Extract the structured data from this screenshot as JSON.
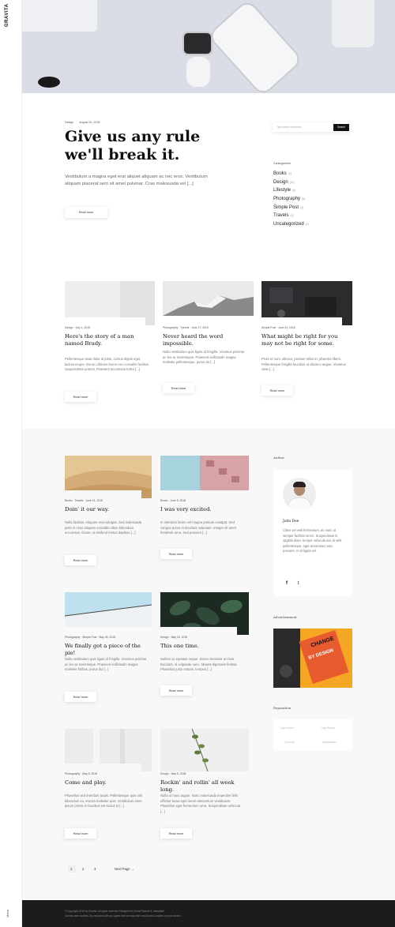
{
  "site": {
    "logo": "GRAVITA",
    "menu_label": "Menu"
  },
  "featured": {
    "category": "Design",
    "date": "August 20, 2018",
    "title": "Give us any rule we'll break it.",
    "excerpt": "Vestibulum a magna eget erat aliquet aliquam ac nec eros. Vestibulum aliquam placerat sem sit amet pulvinar. Cras malesuada vel [...]",
    "read_more": "Read more"
  },
  "search": {
    "placeholder": "Type search keywords",
    "button": "Search"
  },
  "categories": {
    "heading": "Categories",
    "items": [
      {
        "label": "Books",
        "count": "(3)"
      },
      {
        "label": "Design",
        "count": "(11)"
      },
      {
        "label": "Lifestyle",
        "count": "(4)"
      },
      {
        "label": "Photography",
        "count": "(6)"
      },
      {
        "label": "Simple Post",
        "count": "(4)"
      },
      {
        "label": "Travels",
        "count": "(4)"
      },
      {
        "label": "Uncategorized",
        "count": "(2)"
      }
    ]
  },
  "row_posts": [
    {
      "meta": "Design  ·  July 1, 2018",
      "title": "Here's the story of a man named Brady.",
      "excerpt": "Pellentesque vitae dolor id justo, cursus dignis eget, lacinia neque. Donec ultricies lorem nec convallis facilisis. Suspendisse potenti. Praesent accumsan tortor [...]",
      "read_more": "Read more"
    },
    {
      "meta": "Photography · Travels  ·  June 27, 2018",
      "title": "Never heard the word impossible.",
      "excerpt": "Nulla vestibulum quis ligula id fringilla. Vivamus pulvinar ac leo ac scelerisque. Praesent sollicitudin magna molestie pellentesque, purus du [...]",
      "read_more": "Read more"
    },
    {
      "meta": "Simple Post  ·  June 23, 2018",
      "title": "What might be right for you may not be right for some.",
      "excerpt": "Proin et nunc ultrices, pretium tellus in, pharetra libero. Pellentesque fringilla faucibus ut ullamco augue. Vivamus vitae [...]",
      "read_more": "Read more"
    }
  ],
  "grid_posts": [
    {
      "meta": "Books · Travels  ·  June 14, 2018",
      "title": "Doin' it our way.",
      "excerpt": "Nulla facilisis. Aliquam erat volutpat. Sed malesuada justo in risus aliquam convallis ullam bibendum accumsan. Donec ut eleifend metus dapibus [...]",
      "read_more": "Read more"
    },
    {
      "meta": "Books  ·  June 5, 2018",
      "title": "I was very excited.",
      "excerpt": "In interdum lorem vel magna pretium volutpat. Sed congue purus in tincidunt vulputate. Integer sit amet hendrerit urna. Sed posuere [...]",
      "read_more": "Read more"
    },
    {
      "meta": "Photography · Simple Post  ·  May 28, 2018",
      "title": "We finally got a piece of the pie!",
      "excerpt": "Nulla vestibulum quis ligula id fringilla. Vivamus pulvinar ac leo ac scelerisque. Praesent sollicitudin magna molestie finibus, purus dui [...]",
      "read_more": "Read more"
    },
    {
      "meta": "Design  ·  May 16, 2018",
      "title": "This one time.",
      "excerpt": "Nullam ac egestas neque. Donec tincidunt at risus tincidunt, id vulputate nunc. Mauris dignissim finibus. Phasellus justo mauris, tempus [...]",
      "read_more": "Read more"
    },
    {
      "meta": "Photography  ·  May 8, 2018",
      "title": "Come and play.",
      "excerpt": "Phasellus sed interdum turpis. Pellentesque quis nisl bibendum ex, viverra molestie quis. Vestibulum enim ipsum primis in faucibus est luctus et [...]",
      "read_more": "Read more"
    },
    {
      "meta": "Design  ·  May 8, 2018",
      "title": "Rockin' and rollin' all week long.",
      "excerpt": "Nulla ut nunc augue. Nunc malesuada imperdiet felis efficitur lacus eget lorem elementum vestibulum. Phasellus eget fermentum urna. Suspendisse vehicula [...]",
      "read_more": "Read more"
    }
  ],
  "sidebar": {
    "author_heading": "Author",
    "author_name": "John Doe",
    "author_bio": "Class vel velit fermentum, ac nunc at semper facilisis lorem. Suspendisse in sagittis diam, tempor vehicula nisi at velit pellentesque, eget accumsan nunc posuere. In id ligula vel.",
    "facebook": "f",
    "twitter": "t",
    "ad_heading": "Advertisement",
    "ad_text_1": "CHANGE",
    "ad_text_2": "BY DESIGN",
    "rep_heading": "Reputation",
    "rep_logos": [
      "Logo Brand",
      "Logo Brand",
      "Comedy",
      "Ideamakers"
    ]
  },
  "pagination": {
    "pages": [
      "1",
      "2",
      "3"
    ],
    "next": "Next Page →"
  },
  "footer": {
    "line1": "© Copyright 2018 by Gravita. All rights reserved. Designed by ArrowThemes & Jcampbell.",
    "line2": "Gravita uses cookies. By using this site you agree that we may store and access cookies on your device."
  }
}
